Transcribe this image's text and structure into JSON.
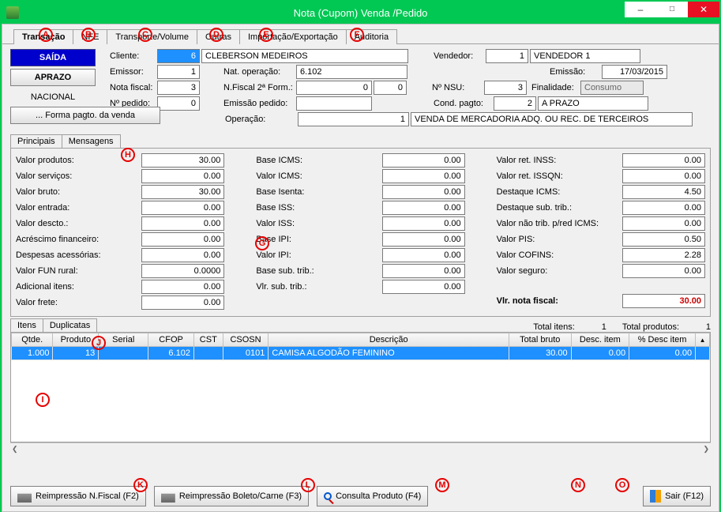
{
  "window": {
    "title": "Nota (Cupom) Venda /Pedido"
  },
  "main_tabs": [
    "Transação",
    "NFE",
    "Transporte/Volume",
    "Outras",
    "Importação/Exportação",
    "Auditoria"
  ],
  "header": {
    "saida": "SAÍDA",
    "aprazo": "APRAZO",
    "nacional": "NACIONAL",
    "forma_pagto_btn": "... Forma pagto. da venda",
    "cliente_lbl": "Cliente:",
    "cliente_cod": "6",
    "cliente_nome": "CLEBERSON MEDEIROS",
    "emissor_lbl": "Emissor:",
    "emissor": "1",
    "nota_fiscal_lbl": "Nota fiscal:",
    "nota_fiscal": "3",
    "num_pedido_lbl": "Nº pedido:",
    "num_pedido": "0",
    "nat_oper_lbl": "Nat. operação:",
    "nat_oper": "6.102",
    "nfiscal2_lbl": "N.Fiscal 2ª Form.:",
    "nfiscal2_a": "0",
    "nfiscal2_b": "0",
    "emissao_pedido_lbl": "Emissão pedido:",
    "emissao_pedido": "",
    "operacao_lbl": "Operação:",
    "operacao_cod": "1",
    "operacao_desc": "VENDA DE MERCADORIA ADQ. OU REC. DE TERCEIROS",
    "vendedor_lbl": "Vendedor:",
    "vendedor_cod": "1",
    "vendedor_nome": "VENDEDOR 1",
    "emissao_lbl": "Emissão:",
    "emissao": "17/03/2015",
    "nsu_lbl": "Nº NSU:",
    "nsu": "3",
    "finalidade_lbl": "Finalidade:",
    "finalidade": "Consumo",
    "cond_pagto_lbl": "Cond. pagto:",
    "cond_pagto_cod": "2",
    "cond_pagto_desc": "A PRAZO"
  },
  "sub_tabs1": [
    "Principais",
    "Mensagens"
  ],
  "values": {
    "col1": [
      {
        "lbl": "Valor produtos:",
        "v": "30.00"
      },
      {
        "lbl": "Valor serviços:",
        "v": "0.00"
      },
      {
        "lbl": "Valor bruto:",
        "v": "30.00"
      },
      {
        "lbl": "Valor entrada:",
        "v": "0.00"
      },
      {
        "lbl": "Valor descto.:",
        "v": "0.00"
      },
      {
        "lbl": "Acréscimo financeiro:",
        "v": "0.00"
      },
      {
        "lbl": "Despesas acessórias:",
        "v": "0.00"
      },
      {
        "lbl": "Valor FUN rural:",
        "v": "0.0000"
      },
      {
        "lbl": "Adicional itens:",
        "v": "0.00"
      },
      {
        "lbl": "Valor frete:",
        "v": "0.00"
      }
    ],
    "col2": [
      {
        "lbl": "Base ICMS:",
        "v": "0.00"
      },
      {
        "lbl": "Valor ICMS:",
        "v": "0.00"
      },
      {
        "lbl": "Base Isenta:",
        "v": "0.00"
      },
      {
        "lbl": "Base ISS:",
        "v": "0.00"
      },
      {
        "lbl": "Valor ISS:",
        "v": "0.00"
      },
      {
        "lbl": "Base IPI:",
        "v": "0.00"
      },
      {
        "lbl": "Valor IPI:",
        "v": "0.00"
      },
      {
        "lbl": "Base sub. trib.:",
        "v": "0.00"
      },
      {
        "lbl": "Vlr. sub. trib.:",
        "v": "0.00"
      }
    ],
    "col3": [
      {
        "lbl": "Valor ret. INSS:",
        "v": "0.00"
      },
      {
        "lbl": "Valor ret. ISSQN:",
        "v": "0.00"
      },
      {
        "lbl": "Destaque ICMS:",
        "v": "4.50"
      },
      {
        "lbl": "Destaque sub. trib.:",
        "v": "0.00"
      },
      {
        "lbl": "Valor não trib. p/red ICMS:",
        "v": "0.00"
      },
      {
        "lbl": "Valor PIS:",
        "v": "0.50"
      },
      {
        "lbl": "Valor COFINS:",
        "v": "2.28"
      },
      {
        "lbl": "Valor seguro:",
        "v": "0.00"
      }
    ],
    "total_lbl": "Vlr. nota fiscal:",
    "total": "30.00"
  },
  "sub_tabs2": [
    "Itens",
    "Duplicatas"
  ],
  "items_summary": {
    "total_itens_lbl": "Total itens:",
    "total_itens": "1",
    "total_produtos_lbl": "Total produtos:",
    "total_produtos": "1"
  },
  "grid": {
    "headers": [
      "Qtde.",
      "Produto",
      "Serial",
      "CFOP",
      "CST",
      "CSOSN",
      "Descrição",
      "Total bruto",
      "Desc. item",
      "% Desc item"
    ],
    "rows": [
      {
        "qtde": "1.000",
        "produto": "13",
        "serial": "",
        "cfop": "6.102",
        "cst": "",
        "csosn": "0101",
        "desc": "CAMISA ALGODÃO FEMININO",
        "total": "30.00",
        "descitem": "0.00",
        "pdesc": "0.00"
      }
    ]
  },
  "footer": {
    "reimp_nf": "Reimpressão N.Fiscal (F2)",
    "reimp_boleto": "Reimpressão Boleto/Carne (F3)",
    "consulta": "Consulta Produto (F4)",
    "sair": "Sair (F12)"
  },
  "markers": [
    "A",
    "B",
    "C",
    "D",
    "E",
    "F",
    "G",
    "H",
    "I",
    "J",
    "K",
    "L",
    "M",
    "N",
    "O"
  ]
}
